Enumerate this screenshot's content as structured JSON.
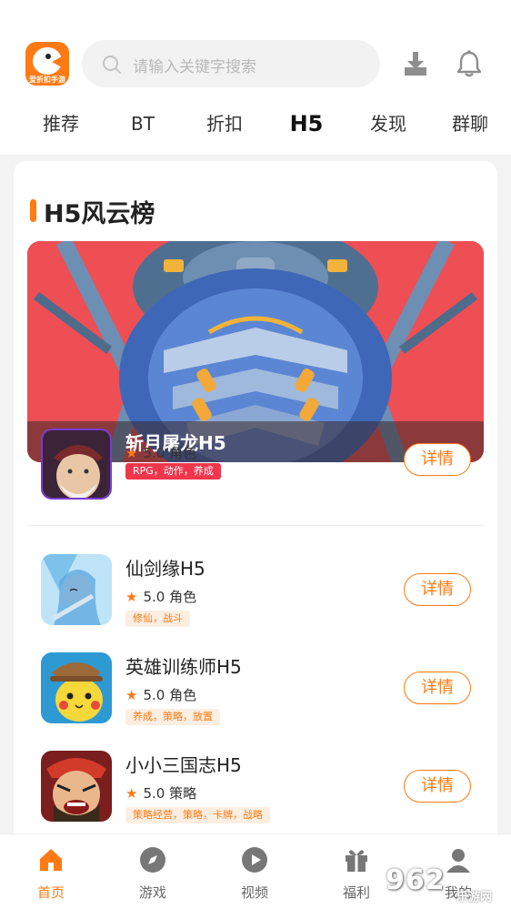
{
  "header": {
    "logo_text": "爱折扣手游",
    "search_placeholder": "请输入关键字搜索"
  },
  "tabs": [
    {
      "label": "推荐"
    },
    {
      "label": "BT"
    },
    {
      "label": "折扣"
    },
    {
      "label": "H5",
      "active": true
    },
    {
      "label": "发现"
    },
    {
      "label": "群聊"
    }
  ],
  "section": {
    "title": "H5风云榜"
  },
  "banner": {
    "title": "斩月屠龙H5"
  },
  "games": [
    {
      "name": "",
      "rating": "5.0",
      "category": "角色",
      "tags": "RPG，动作，养成",
      "button": "详情"
    },
    {
      "name": "仙剑缘H5",
      "rating": "5.0",
      "category": "角色",
      "tags": "修仙，战斗",
      "button": "详情"
    },
    {
      "name": "英雄训练师H5",
      "rating": "5.0",
      "category": "角色",
      "tags": "养成，策略，放置",
      "button": "详情"
    },
    {
      "name": "小小三国志H5",
      "rating": "5.0",
      "category": "策略",
      "tags": "策略经营，策略，卡牌，战略",
      "button": "详情"
    }
  ],
  "nav": [
    {
      "label": "首页",
      "icon": "home-icon",
      "active": true
    },
    {
      "label": "游戏",
      "icon": "compass-icon"
    },
    {
      "label": "视频",
      "icon": "video-play-icon"
    },
    {
      "label": "福利",
      "icon": "gift-icon"
    },
    {
      "label": "我的",
      "icon": "user-icon"
    }
  ],
  "watermark": {
    "line1": "962",
    "line2": "乐游网"
  },
  "colors": {
    "accent": "#ff7a12",
    "tag_red": "#f0364d"
  }
}
